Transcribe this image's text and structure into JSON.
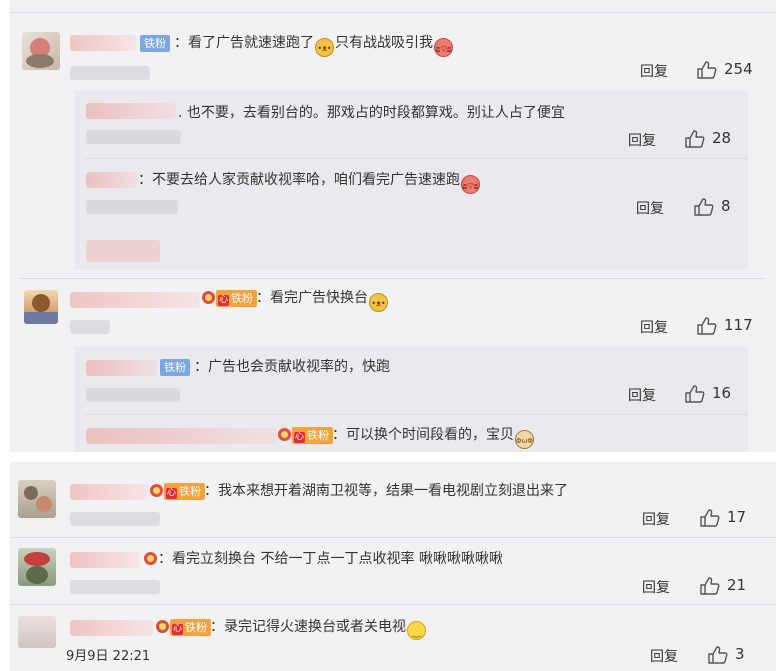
{
  "upper": {
    "comments": [
      {
        "badge": "铁粉",
        "text": "：看了广告就速速跑了",
        "text2": "只有战战吸引我",
        "reply": "回复",
        "likes": "254",
        "replies": [
          {
            "text": ". 也不要，去看别台的。那戏占的时段都算戏。别让人占了便宜",
            "reply": "回复",
            "likes": "28"
          },
          {
            "text": "：不要去给人家贡献收视率哈，咱们看完广告速速跑",
            "reply": "回复",
            "likes": "8"
          }
        ]
      },
      {
        "badge": "铁粉",
        "text": "：看完广告快换台",
        "reply": "回复",
        "likes": "117",
        "replies": [
          {
            "badge": "铁粉",
            "text": "：广告也会贡献收视率的，快跑",
            "reply": "回复",
            "likes": "16"
          },
          {
            "badge": "铁粉",
            "text": "：可以换个时间段看的，宝贝"
          }
        ]
      }
    ]
  },
  "lower": {
    "comments": [
      {
        "badge": "铁粉",
        "text": "：我本来想开着湖南卫视等，结果一看电视剧立刻退出来了",
        "reply": "回复",
        "likes": "17"
      },
      {
        "text": "：看完立刻换台  不给一丁点一丁点收视率 啾啾啾啾啾啾",
        "reply": "回复",
        "likes": "21"
      },
      {
        "badge": "铁粉",
        "text": "：录完记得火速换台或者关电视",
        "time": "9月9日 22:21",
        "reply": "回复",
        "likes": "3"
      }
    ]
  }
}
